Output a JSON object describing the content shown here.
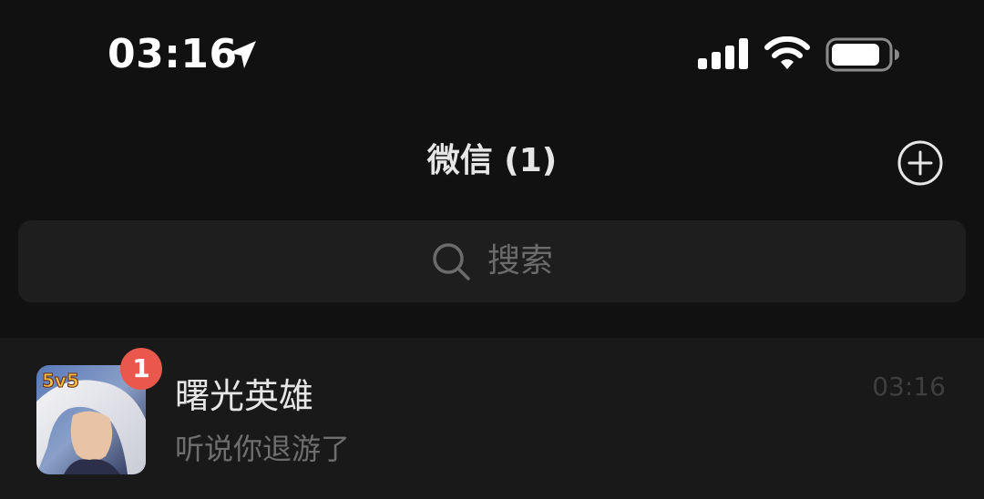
{
  "status_bar": {
    "time": "03:16",
    "icons": [
      "location-arrow-icon",
      "cellular-signal-icon",
      "wifi-icon",
      "battery-icon"
    ]
  },
  "header": {
    "title": "微信 (1)",
    "add_icon": "plus-circle-icon"
  },
  "search": {
    "placeholder": "搜索",
    "icon": "search-icon"
  },
  "chats": [
    {
      "name": "曙光英雄",
      "preview": "听说你退游了",
      "time": "03:16",
      "unread": "1",
      "avatar_text": "5v5"
    }
  ],
  "colors": {
    "background": "#111111",
    "search_bg": "#1e1e1e",
    "list_bg": "#191919",
    "badge": "#e9574d",
    "title_text": "#e6e6e6",
    "secondary_text": "#6e6e6e"
  }
}
